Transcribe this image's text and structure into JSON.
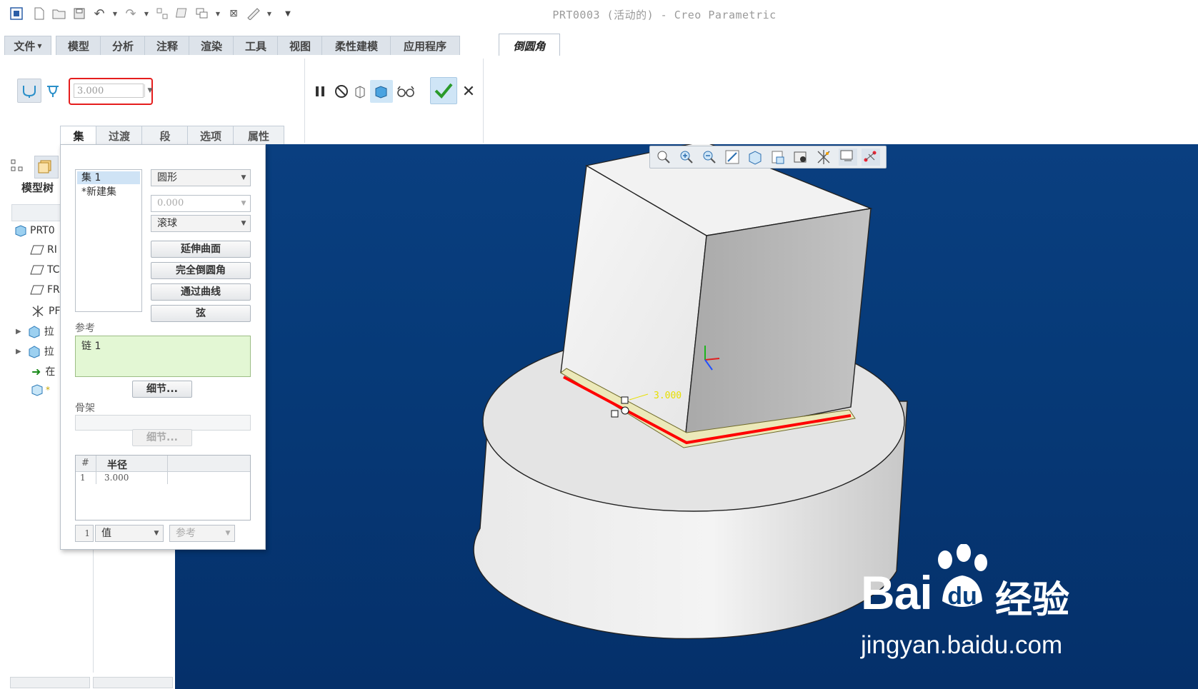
{
  "window": {
    "title": "PRT0003 (活动的) - Creo Parametric"
  },
  "ribbon_tabs": [
    {
      "label": "文件"
    },
    {
      "label": "模型"
    },
    {
      "label": "分析"
    },
    {
      "label": "注释"
    },
    {
      "label": "渲染"
    },
    {
      "label": "工具"
    },
    {
      "label": "视图"
    },
    {
      "label": "柔性建模"
    },
    {
      "label": "应用程序"
    },
    {
      "label": "倒圆角"
    }
  ],
  "round": {
    "radius_value": "3.000"
  },
  "sub_tabs": [
    {
      "label": "集"
    },
    {
      "label": "过渡"
    },
    {
      "label": "段"
    },
    {
      "label": "选项"
    },
    {
      "label": "属性"
    }
  ],
  "model_tree": {
    "tab_label": "模型树",
    "items": [
      {
        "label": "PRT0"
      },
      {
        "label": "RI"
      },
      {
        "label": "TC"
      },
      {
        "label": "FR"
      },
      {
        "label": "PF"
      },
      {
        "label": "拉"
      },
      {
        "label": "拉"
      },
      {
        "label": "在"
      },
      {
        "label": "*"
      }
    ]
  },
  "sets_panel": {
    "sets": [
      {
        "label": "集 1"
      },
      {
        "label": "*新建集"
      }
    ],
    "cross_section": "圆形",
    "distance_value": "0.000",
    "method": "滚球",
    "buttons": {
      "extend": "延伸曲面",
      "full_round": "完全倒圆角",
      "through_curve": "通过曲线",
      "chord": "弦"
    },
    "references_label": "参考",
    "reference_item": "链 1",
    "details_label": "细节...",
    "skeleton_label": "骨架",
    "skeleton_details_label": "细节...",
    "radius_table": {
      "headers": [
        "#",
        "半径"
      ],
      "rows": [
        {
          "index": "1",
          "radius": "3.000"
        }
      ]
    },
    "footer": {
      "row_index": "1",
      "value_mode": "值",
      "reference_mode": "参考"
    }
  },
  "viewport": {
    "dimension_label": "3.000"
  },
  "watermark": {
    "brand": "Bai",
    "brand_suffix": "经验",
    "url": "jingyan.baidu.com"
  },
  "colors": {
    "accent_red": "#e51d1d",
    "viewport_blue": "#063a78",
    "fillet_highlight": "#ff0000",
    "ok_green": "#2a9a2a"
  }
}
